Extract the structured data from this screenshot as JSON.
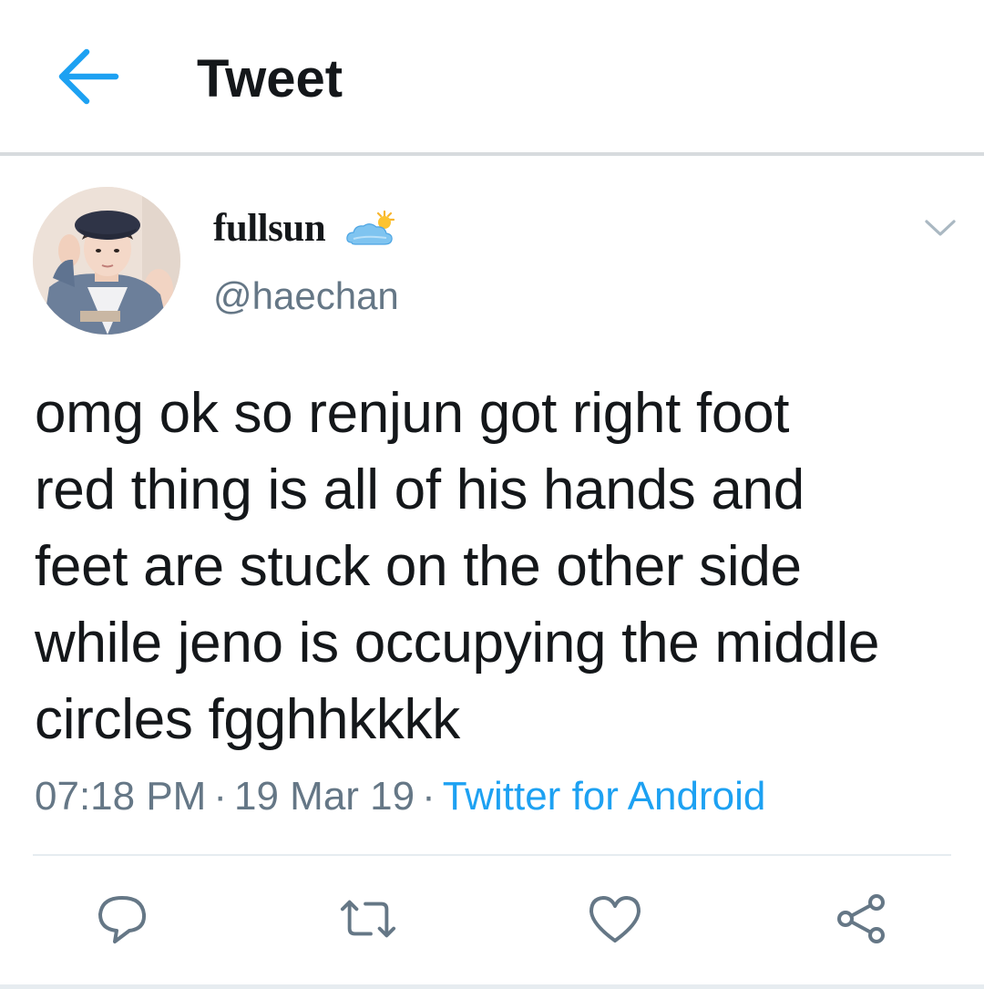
{
  "header": {
    "title": "Tweet",
    "back_icon": "arrow-left-icon",
    "accent_color": "#1da1f2"
  },
  "author": {
    "display_name": "fullsun",
    "name_emoji": "sun-behind-cloud-emoji",
    "handle": "@haechan"
  },
  "tweet": {
    "lines": [
      "omg ok so renjun got right foot",
      "red thing is all of his hands and",
      "feet are stuck on the other side",
      "while jeno is occupying the middle",
      "circles fgghhkkkk"
    ]
  },
  "meta": {
    "time": "07:18 PM",
    "separator": "·",
    "date": "19 Mar 19",
    "source": "Twitter for Android"
  },
  "actions": {
    "reply_icon": "reply-icon",
    "retweet_icon": "retweet-icon",
    "like_icon": "heart-icon",
    "share_icon": "share-icon"
  },
  "colors": {
    "text": "#14171a",
    "secondary": "#657786",
    "link": "#1da1f2",
    "divider": "#e6ecf0"
  }
}
